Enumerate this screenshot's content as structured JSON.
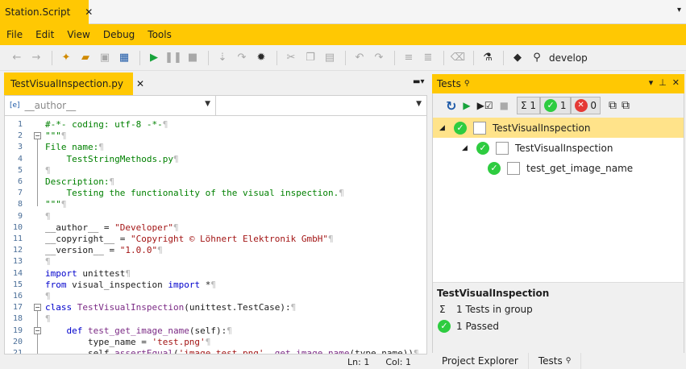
{
  "app": {
    "doc_tab": "Station.Script",
    "close": "✕"
  },
  "menu": [
    "File",
    "Edit",
    "View",
    "Debug",
    "Tools"
  ],
  "toolbar": {
    "branch": "develop"
  },
  "editor": {
    "tab": "TestVisualInspection.py",
    "tab_close": "✕",
    "dropdown1": "__author__",
    "dropdown1_icon": "[e]",
    "dropdown2": "",
    "lines": [
      [
        [
          "cm",
          "#-*- coding: utf-8 -*-"
        ]
      ],
      [
        [
          "cm",
          "\"\"\""
        ]
      ],
      [
        [
          "cm",
          "File name:"
        ]
      ],
      [
        [
          "cm",
          "    TestStringMethods.py"
        ]
      ],
      [
        [
          "cm",
          ""
        ]
      ],
      [
        [
          "cm",
          "Description:"
        ]
      ],
      [
        [
          "cm",
          "    Testing the functionality of the visual inspection."
        ]
      ],
      [
        [
          "cm",
          "\"\"\""
        ]
      ],
      [
        [
          "tx",
          ""
        ]
      ],
      [
        [
          "tx",
          "__author__ = "
        ],
        [
          "st",
          "\"Developer\""
        ]
      ],
      [
        [
          "tx",
          "__copyright__ = "
        ],
        [
          "st",
          "\"Copyright © Löhnert Elektronik GmbH\""
        ]
      ],
      [
        [
          "tx",
          "__version__ = "
        ],
        [
          "st",
          "\"1.0.0\""
        ]
      ],
      [
        [
          "tx",
          ""
        ]
      ],
      [
        [
          "kw",
          "import"
        ],
        [
          "tx",
          " unittest"
        ]
      ],
      [
        [
          "kw",
          "from"
        ],
        [
          "tx",
          " visual_inspection "
        ],
        [
          "kw",
          "import"
        ],
        [
          "tx",
          " *"
        ]
      ],
      [
        [
          "tx",
          ""
        ]
      ],
      [
        [
          "kw",
          "class"
        ],
        [
          "tx",
          " "
        ],
        [
          "fn",
          "TestVisualInspection"
        ],
        [
          "tx",
          "(unittest.TestCase):"
        ]
      ],
      [
        [
          "tx",
          ""
        ]
      ],
      [
        [
          "tx",
          "    "
        ],
        [
          "kw",
          "def"
        ],
        [
          "tx",
          " "
        ],
        [
          "fn",
          "test_get_image_name"
        ],
        [
          "tx",
          "(self):"
        ]
      ],
      [
        [
          "tx",
          "        type_name = "
        ],
        [
          "st",
          "'test.png'"
        ]
      ],
      [
        [
          "tx",
          "        self."
        ],
        [
          "fn",
          "assertEqual"
        ],
        [
          "tx",
          "("
        ],
        [
          "st",
          "'image_test.png'"
        ],
        [
          "tx",
          ", "
        ],
        [
          "fn",
          "get_image_name"
        ],
        [
          "tx",
          "(type_name))"
        ]
      ]
    ],
    "status": {
      "ln": "Ln: 1",
      "col": "Col: 1"
    }
  },
  "tests": {
    "title": "Tests",
    "pin": "📌",
    "counts": {
      "sigma": "Σ",
      "total": "1",
      "passed": "1",
      "failed": "0"
    },
    "tree": [
      {
        "label": "TestVisualInspection",
        "level": 0,
        "selected": true
      },
      {
        "label": "TestVisualInspection",
        "level": 1,
        "selected": false
      },
      {
        "label": "test_get_image_name",
        "level": 2,
        "selected": false
      }
    ],
    "summary": {
      "title": "TestVisualInspection",
      "sigma": "Σ",
      "tests_in_group": "1 Tests in group",
      "passed": "1 Passed"
    },
    "bottom_tabs": [
      "Project Explorer",
      "Tests"
    ]
  },
  "colors": {
    "accent": "#ffc803",
    "pass": "#2ecc40",
    "fail": "#e53935"
  }
}
